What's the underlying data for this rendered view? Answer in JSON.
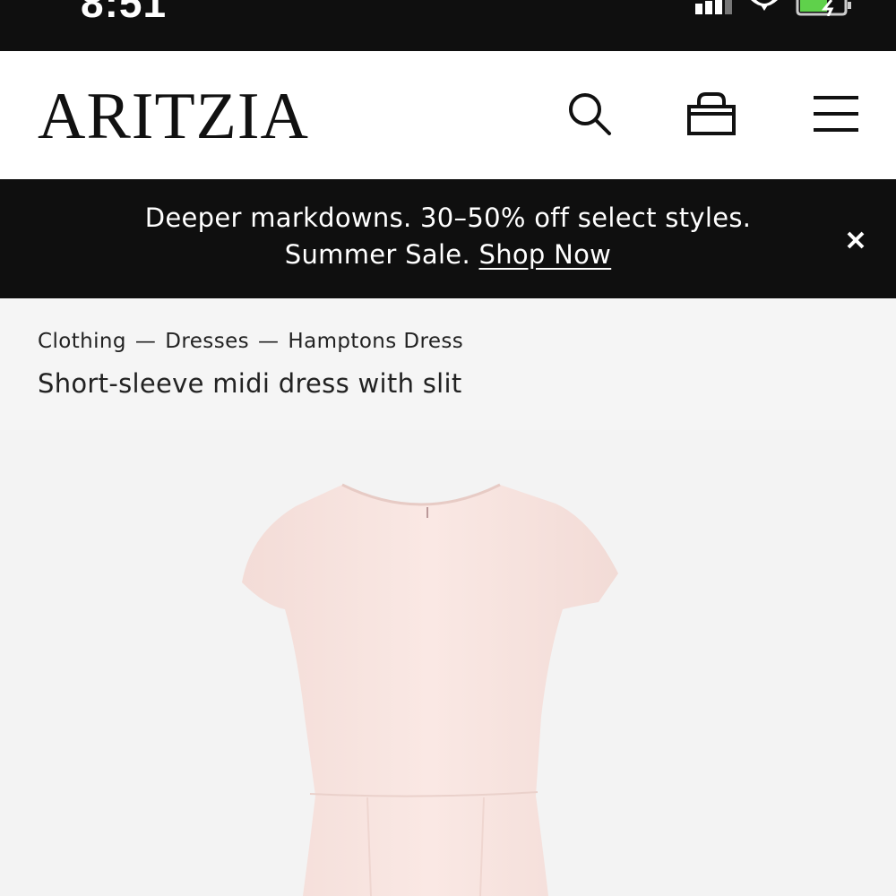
{
  "status_bar": {
    "time": "8:51"
  },
  "header": {
    "logo": "ARITZIA",
    "icons": [
      "search-icon",
      "bag-icon",
      "menu-icon"
    ]
  },
  "promo": {
    "line1": "Deeper markdowns. 30–50% off select styles.",
    "line2_prefix": "Summer Sale. ",
    "link": "Shop Now",
    "close_icon": "close-icon"
  },
  "breadcrumb": {
    "items": [
      "Clothing",
      "Dresses",
      "Hamptons Dress"
    ],
    "separator": "—"
  },
  "product": {
    "title": "Short-sleeve midi dress with slit",
    "image": "dress-photo",
    "dress_color": "#f9e6e2"
  },
  "colors": {
    "banner_bg": "#0f0f0f",
    "header_bg": "#ffffff",
    "page_bg": "#f5f5f5",
    "battery_charge": "#5fd14b"
  }
}
